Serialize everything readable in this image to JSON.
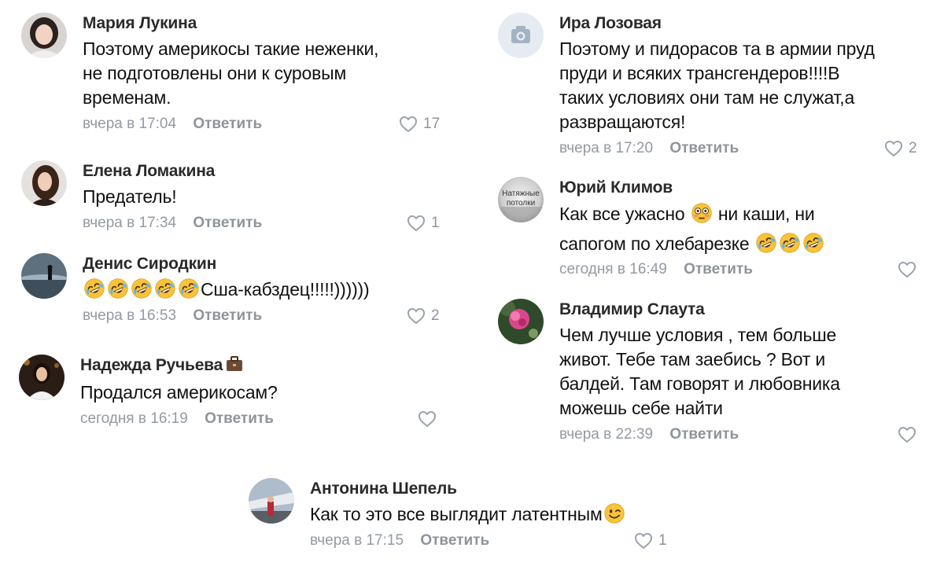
{
  "comments": [
    {
      "author": "Мария Лукина",
      "lines": [
        "Поэтому америкосы такие неженки,",
        "не подготовлены они к суровым",
        "временам."
      ],
      "time": "вчера в 17:04",
      "reply": "Ответить",
      "likes": "17",
      "avatar_icon": "user-photo-avatar"
    },
    {
      "author": "Елена Ломакина",
      "lines": [
        "Предатель!"
      ],
      "time": "вчера в 17:34",
      "reply": "Ответить",
      "likes": "1",
      "avatar_icon": "user-photo-avatar"
    },
    {
      "author": "Денис Сиродкин",
      "text": "Сша-кабздец!!!!!))))))",
      "emoji": "rolling-on-floor-laughing-emoji",
      "time": "вчера в 16:53",
      "reply": "Ответить",
      "likes": "2",
      "avatar_icon": "user-photo-avatar"
    },
    {
      "author": "Надежда Ручьева",
      "badge_icon": "briefcase-icon",
      "lines": [
        "Продался америкосам?"
      ],
      "time": "сегодня в 16:19",
      "reply": "Ответить",
      "likes": "",
      "avatar_icon": "user-photo-avatar"
    },
    {
      "author": "Ира Лозовая",
      "lines": [
        "Поэтому и пидорасов та в армии пруд",
        "пруди и всяких трансгендеров!!!!В",
        "таких условиях они там не служат,а",
        "развращаются!"
      ],
      "time": "вчера в 17:20",
      "reply": "Ответить",
      "likes": "2",
      "avatar_icon": "camera-placeholder-icon"
    },
    {
      "author": "Юрий Климов",
      "avatar_text": "Натяжные потолки",
      "line1_text": "Как все ужасно",
      "line1_after": "ни каши, ни",
      "line1_emoji": "flushed-face-emoji",
      "line2_text": "сапогом по хлебарезке",
      "line2_emoji": "rolling-on-floor-laughing-emoji",
      "time": "сегодня в 16:49",
      "reply": "Ответить",
      "likes": ""
    },
    {
      "author": "Владимир Слаута",
      "lines": [
        "Чем лучше условия , тем больше",
        "живот. Тебе там заебись ? Вот и",
        "балдей. Там говорят и любовника",
        "можешь себе найти"
      ],
      "time": "вчера в 22:39",
      "reply": "Ответить",
      "likes": "",
      "avatar_icon": "flower-photo-avatar"
    },
    {
      "author": "Антонина Шепель",
      "text": "Как то это все выглядит латентным",
      "emoji": "winking-face-emoji",
      "time": "вчера в 17:15",
      "reply": "Ответить",
      "likes": "1",
      "avatar_icon": "user-photo-avatar"
    }
  ],
  "colors": {
    "name": "#2a2a2a",
    "meta": "#939aa3",
    "heart": "#99a2ad",
    "text": "#111111"
  }
}
